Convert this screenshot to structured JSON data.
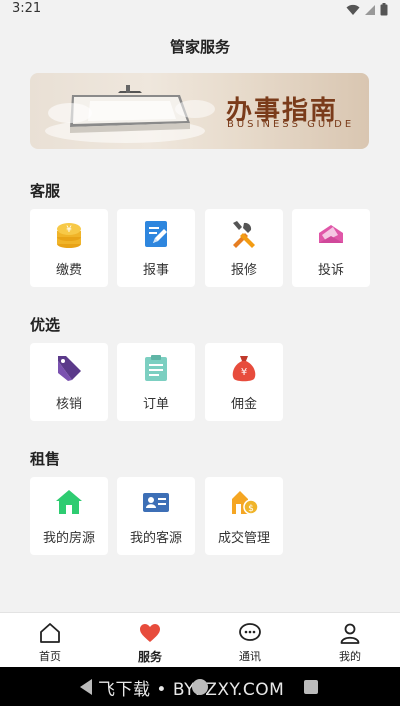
{
  "status_bar": {
    "time": "3:21"
  },
  "header": {
    "title": "管家服务"
  },
  "banner": {
    "title_cn": "办事指南",
    "title_en": "BUSINESS  GUIDE"
  },
  "sections": [
    {
      "title": "客服",
      "items": [
        {
          "label": "缴费",
          "icon": "coins-icon"
        },
        {
          "label": "报事",
          "icon": "edit-note-icon"
        },
        {
          "label": "报修",
          "icon": "tools-icon"
        },
        {
          "label": "投诉",
          "icon": "envelope-icon"
        }
      ]
    },
    {
      "title": "优选",
      "items": [
        {
          "label": "核销",
          "icon": "tag-icon"
        },
        {
          "label": "订单",
          "icon": "clipboard-icon"
        },
        {
          "label": "佣金",
          "icon": "money-bag-icon"
        }
      ]
    },
    {
      "title": "租售",
      "items": [
        {
          "label": "我的房源",
          "icon": "house-icon"
        },
        {
          "label": "我的客源",
          "icon": "id-card-icon"
        },
        {
          "label": "成交管理",
          "icon": "deal-icon"
        }
      ]
    }
  ],
  "tabbar": {
    "items": [
      {
        "label": "首页",
        "icon": "home-icon"
      },
      {
        "label": "服务",
        "icon": "heart-icon",
        "active": true
      },
      {
        "label": "通讯",
        "icon": "chat-icon"
      },
      {
        "label": "我的",
        "icon": "user-icon"
      }
    ]
  },
  "watermark": "飞下载 • BYFZXY.COM",
  "colors": {
    "coin": "#f0b429",
    "edit": "#2e86de",
    "tools": "#e67e22",
    "envelope": "#e056a8",
    "tag": "#5b3a8a",
    "clipboard": "#7ccfc1",
    "bag": "#e74c3c",
    "house": "#2ecc71",
    "idcard": "#3d6fb6",
    "deal": "#f5a623",
    "heart": "#e74c3c"
  }
}
